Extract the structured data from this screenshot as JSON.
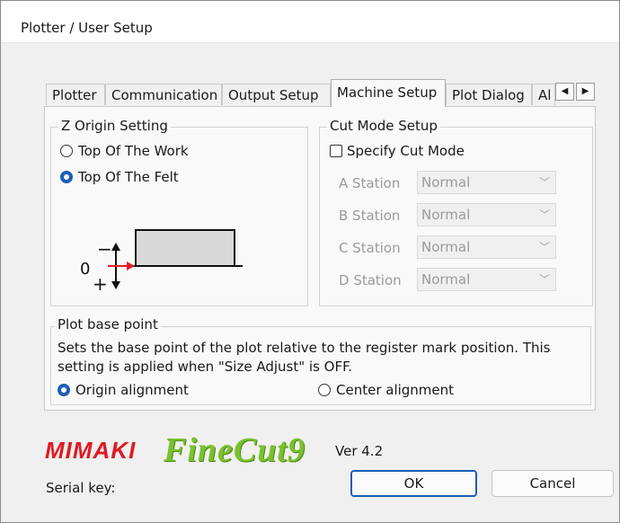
{
  "window": {
    "title": "Plotter / User Setup"
  },
  "tabs": [
    {
      "label": "Plotter"
    },
    {
      "label": "Communication"
    },
    {
      "label": "Output Setup"
    },
    {
      "label": "Machine Setup",
      "active": true
    },
    {
      "label": "Plot Dialog"
    },
    {
      "label": "Al"
    }
  ],
  "tab_scroll": {
    "left": "◀",
    "right": "▶"
  },
  "z_origin": {
    "title": "Z Origin Setting",
    "options": [
      {
        "label": "Top Of The Work",
        "selected": false
      },
      {
        "label": "Top Of The Felt",
        "selected": true
      }
    ],
    "diagram": {
      "zero": "0",
      "minus": "−",
      "plus": "+"
    }
  },
  "cut_mode": {
    "title": "Cut Mode Setup",
    "specify_label": "Specify Cut Mode",
    "specify_checked": false,
    "stations": [
      {
        "label": "A Station",
        "value": "Normal"
      },
      {
        "label": "B Station",
        "value": "Normal"
      },
      {
        "label": "C Station",
        "value": "Normal"
      },
      {
        "label": "D Station",
        "value": "Normal"
      }
    ]
  },
  "plot_base": {
    "title": "Plot base point",
    "description": "Sets the base point of the plot relative to the register mark position. This setting is applied when \"Size Adjust\" is OFF.",
    "options": [
      {
        "label": "Origin alignment",
        "selected": true
      },
      {
        "label": "Center alignment",
        "selected": false
      }
    ]
  },
  "branding": {
    "maker": "MIMAKI",
    "product": "FineCut9",
    "version": "Ver 4.2"
  },
  "serial_label": "Serial key:",
  "buttons": {
    "ok": "OK",
    "cancel": "Cancel"
  },
  "colors": {
    "accent": "#1a5fb4",
    "mimaki_red": "#e01a22",
    "finecut_green": "#7ac12f",
    "arrow_red": "#e0202a"
  }
}
